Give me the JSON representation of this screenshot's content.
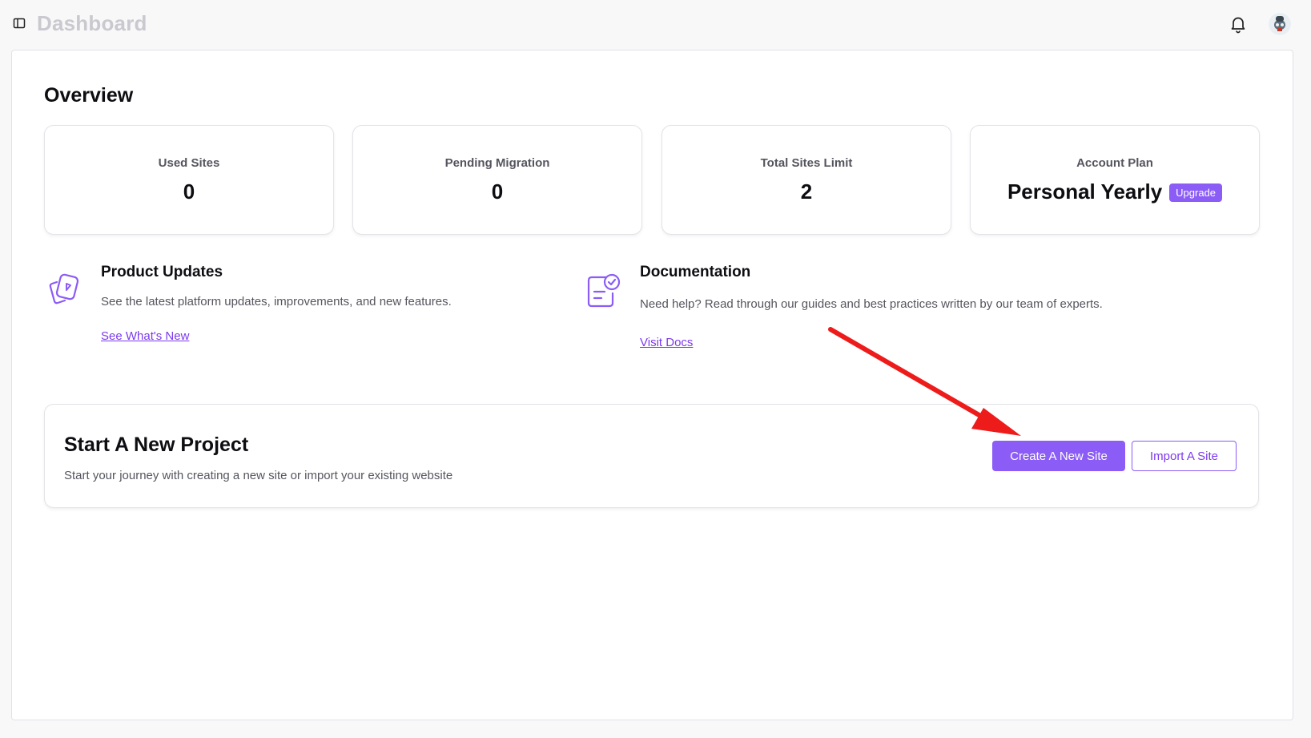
{
  "header": {
    "title": "Dashboard",
    "sidebar_toggle_icon": "sidebar-toggle-icon",
    "notification_icon": "bell-icon",
    "avatar_icon": "user-avatar"
  },
  "overview": {
    "title": "Overview",
    "stats": [
      {
        "label": "Used Sites",
        "value": "0"
      },
      {
        "label": "Pending Migration",
        "value": "0"
      },
      {
        "label": "Total Sites Limit",
        "value": "2"
      },
      {
        "label": "Account Plan",
        "value": "Personal Yearly",
        "badge": "Upgrade"
      }
    ]
  },
  "info": {
    "updates": {
      "icon": "product-updates-icon",
      "title": "Product Updates",
      "description": "See the latest platform updates, improvements, and new features.",
      "link": "See What's New"
    },
    "docs": {
      "icon": "documentation-icon",
      "title": "Documentation",
      "description": "Need help? Read through our guides and best practices written by our team of experts.",
      "link": "Visit Docs"
    }
  },
  "project": {
    "title": "Start A New Project",
    "description": "Start your journey with creating a new site or import your existing website",
    "primary_button": "Create A New Site",
    "secondary_button": "Import A Site"
  },
  "colors": {
    "accent": "#8b5cf6",
    "annotation_arrow": "#ee1b1b"
  }
}
